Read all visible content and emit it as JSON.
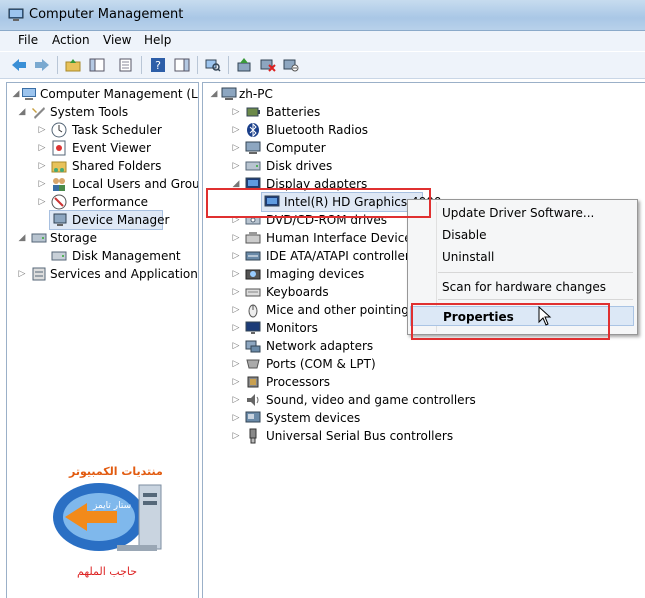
{
  "window": {
    "title": "Computer Management"
  },
  "menu": [
    "File",
    "Action",
    "View",
    "Help"
  ],
  "toolbar_icons": [
    "back-icon",
    "forward-icon",
    "up-folder-icon",
    "show-hide-tree-icon",
    "export-list-icon",
    "help-icon",
    "show-action-pane-icon",
    "scan-hardware-icon",
    "update-driver-icon",
    "uninstall-device-icon",
    "disable-device-icon"
  ],
  "left_tree": {
    "root": "Computer Management (Local",
    "system_tools": "System Tools",
    "task_scheduler": "Task Scheduler",
    "event_viewer": "Event Viewer",
    "shared_folders": "Shared Folders",
    "local_users": "Local Users and Groups",
    "performance": "Performance",
    "device_manager": "Device Manager",
    "storage": "Storage",
    "disk_management": "Disk Management",
    "services": "Services and Applications"
  },
  "device_tree": {
    "computer_name": "zh-PC",
    "batteries": "Batteries",
    "bluetooth": "Bluetooth Radios",
    "computer": "Computer",
    "disk_drives": "Disk drives",
    "display_adapters": "Display adapters",
    "intel_hd": "Intel(R) HD Graphics 4000",
    "dvd": "DVD/CD-ROM drives",
    "hid": "Human Interface Devices",
    "ide": "IDE ATA/ATAPI controllers",
    "imaging": "Imaging devices",
    "keyboards": "Keyboards",
    "mice": "Mice and other pointing de",
    "monitors": "Monitors",
    "network": "Network adapters",
    "ports": "Ports (COM & LPT)",
    "processors": "Processors",
    "sound": "Sound, video and game controllers",
    "system_devices": "System devices",
    "usb": "Universal Serial Bus controllers"
  },
  "context_menu": {
    "update": "Update Driver Software...",
    "disable": "Disable",
    "uninstall": "Uninstall",
    "scan": "Scan for hardware changes",
    "properties": "Properties"
  },
  "watermark": {
    "top_text": "منتديات الكمبيوتر",
    "middle_text": "ستار تايمز",
    "bottom_text": "حاجب الملهم"
  },
  "colors": {
    "highlight_border": "#e03030",
    "selection": "#dfe8f5"
  }
}
